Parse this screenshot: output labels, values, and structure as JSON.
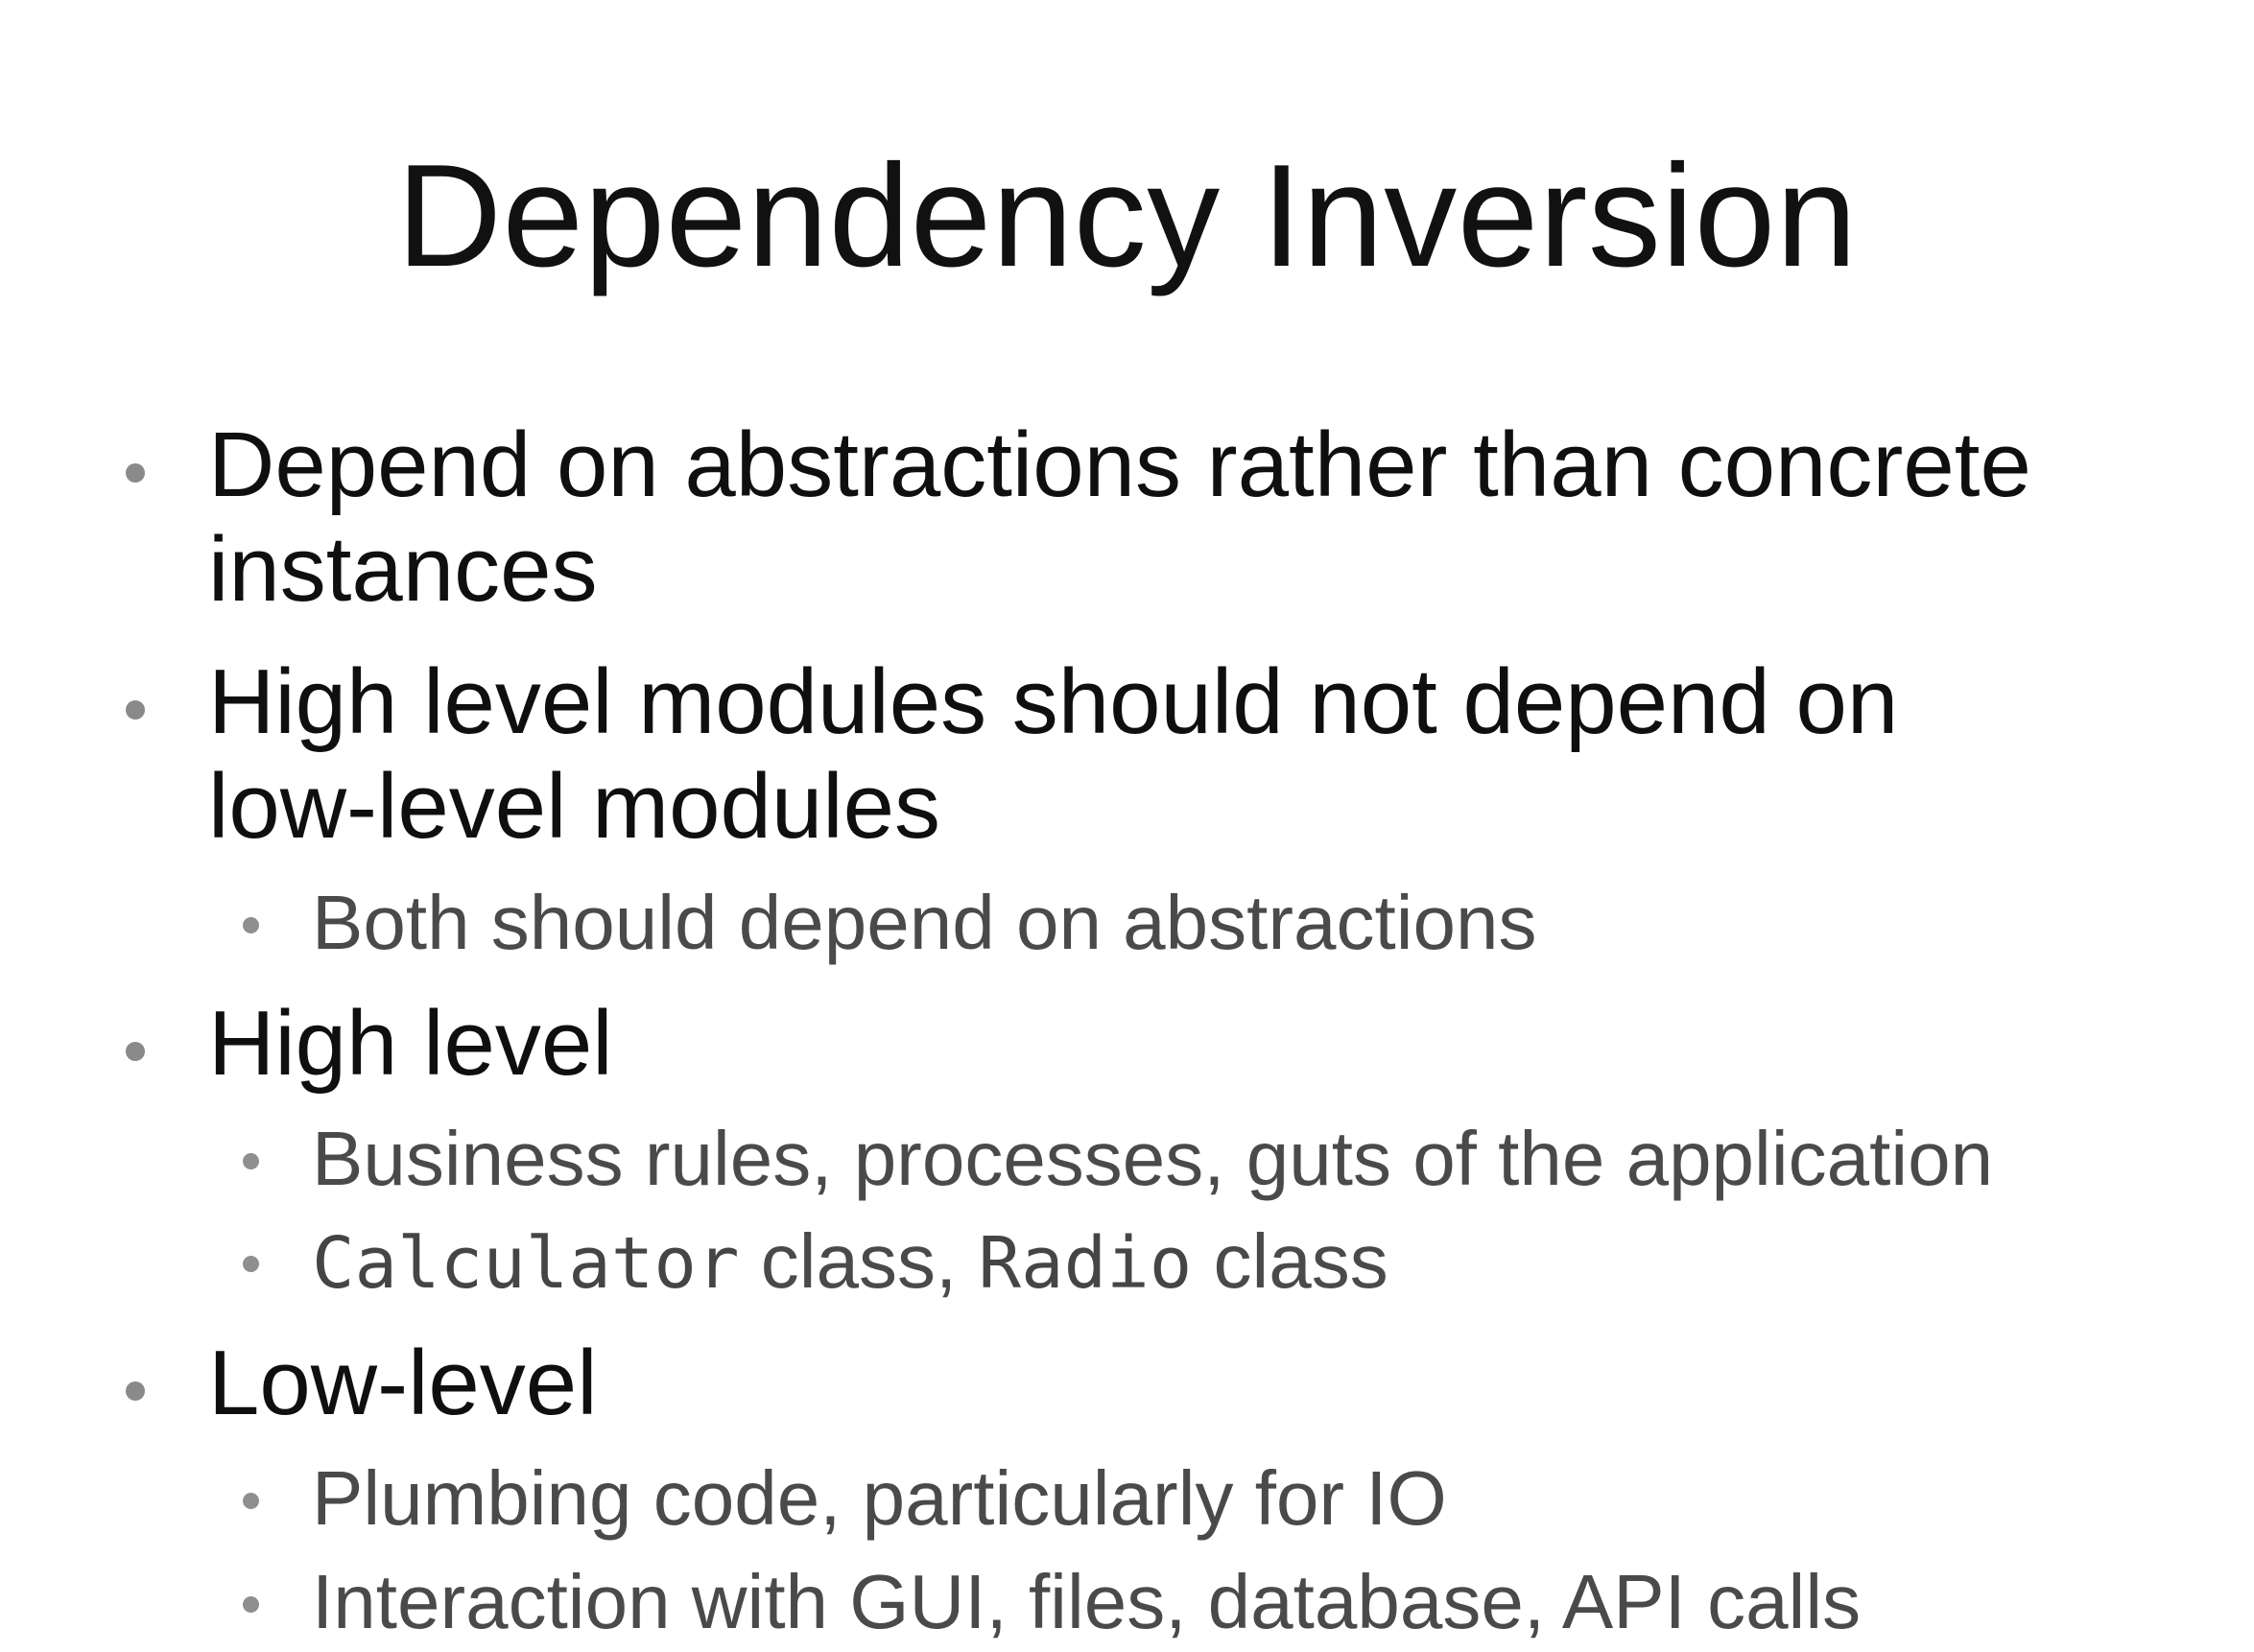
{
  "slide": {
    "title": "Dependency Inversion",
    "bullets": [
      {
        "text_line1": "Depend on abstractions rather than concrete",
        "text_line2": "instances"
      },
      {
        "text_line1": "High level modules should not depend on",
        "text_line2": "low-level modules",
        "sub": [
          {
            "text": "Both should depend on abstractions"
          }
        ]
      },
      {
        "text_line1": "High level",
        "sub": [
          {
            "text": "Business rules, processes, guts of the application"
          },
          {
            "code1": "Calculator",
            "mid": " class, ",
            "code2": "Radio",
            "end": " class"
          }
        ]
      },
      {
        "text_line1": "Low-level",
        "sub": [
          {
            "text": "Plumbing code, particularly for IO"
          },
          {
            "text": "Interaction with GUI, files, database, API calls"
          }
        ]
      }
    ]
  }
}
